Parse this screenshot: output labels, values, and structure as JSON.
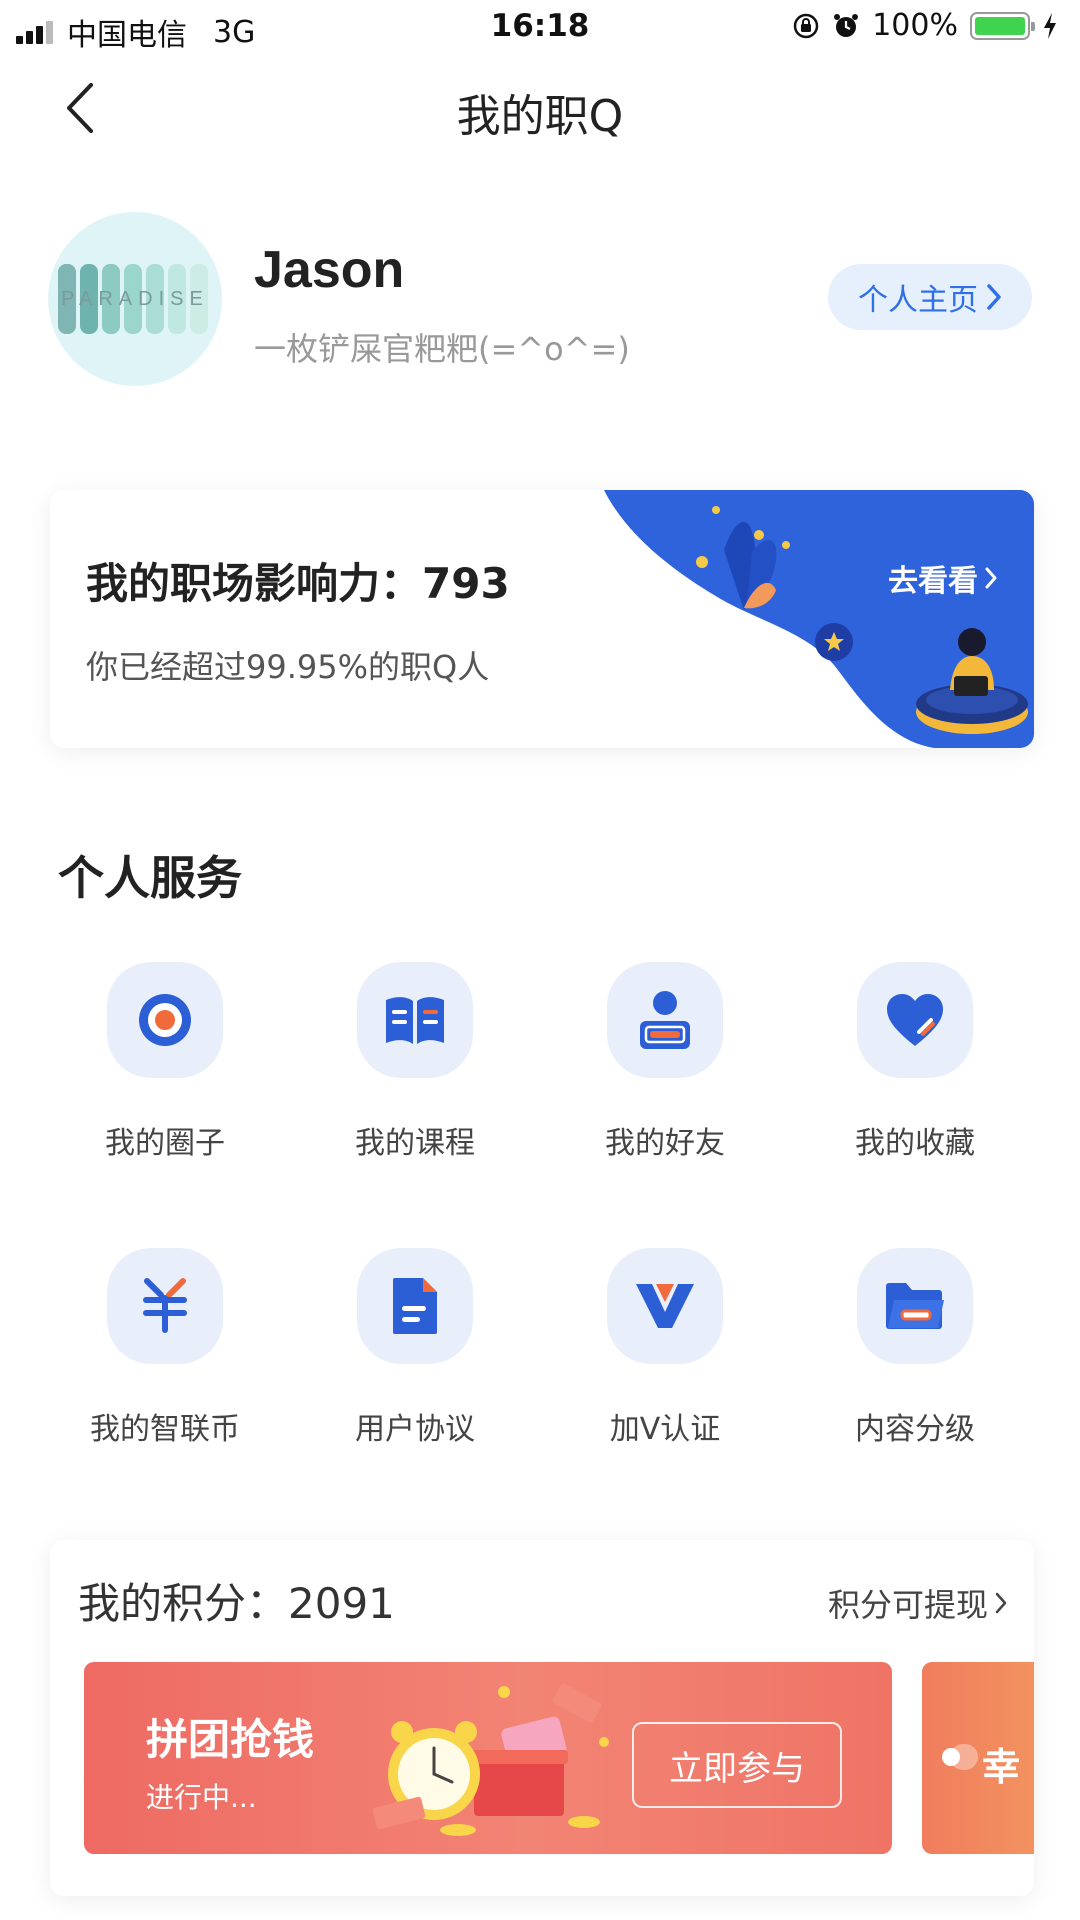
{
  "status_bar": {
    "carrier": "中国电信",
    "network": "3G",
    "time": "16:18",
    "battery": "100%",
    "battery_level": 1.0,
    "icons": [
      "signal-icon",
      "rotation-lock-icon",
      "alarm-icon",
      "battery-icon",
      "charging-icon"
    ]
  },
  "nav": {
    "title": "我的职Q",
    "back_icon": "chevron-left-icon"
  },
  "profile": {
    "avatar_text": "PARADISE",
    "name": "Jason",
    "bio": "一枚铲屎官粑粑(=^o^=)",
    "homepage_label": "个人主页"
  },
  "influence": {
    "title": "我的职场影响力：793",
    "subtitle": "你已经超过99.95%的职Q人",
    "action_label": "去看看"
  },
  "services": {
    "title": "个人服务",
    "items": [
      {
        "label": "我的圈子",
        "icon": "target-icon"
      },
      {
        "label": "我的课程",
        "icon": "book-icon"
      },
      {
        "label": "我的好友",
        "icon": "person-icon"
      },
      {
        "label": "我的收藏",
        "icon": "heart-icon"
      },
      {
        "label": "我的智联币",
        "icon": "yen-icon"
      },
      {
        "label": "用户协议",
        "icon": "document-icon"
      },
      {
        "label": "加V认证",
        "icon": "verified-v-icon"
      },
      {
        "label": "内容分级",
        "icon": "folder-icon"
      }
    ]
  },
  "points": {
    "label": "我的积分：",
    "value": "2091",
    "link_label": "积分可提现",
    "banners": [
      {
        "title": "拼团抢钱",
        "status": "进行中...",
        "button": "立即参与"
      },
      {
        "title": "幸"
      }
    ]
  },
  "colors": {
    "accent": "#2f6fe8",
    "icon_bg": "#e9eefb",
    "icon_blue": "#2c5fd6",
    "icon_orange": "#f06a3c",
    "promo_red": "#ee6a63"
  }
}
